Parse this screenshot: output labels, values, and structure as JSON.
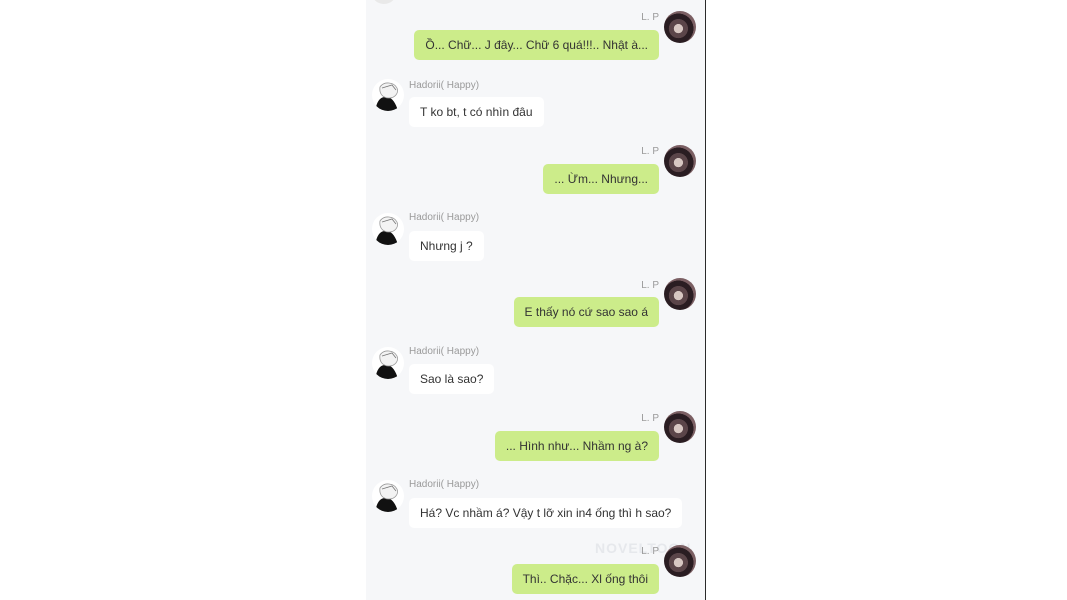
{
  "chat": {
    "watermark": "NOVELTOON",
    "messages": [
      {
        "side": "right",
        "name": "L. P",
        "text": "Ồ... Chữ... J đây... Chữ 6 quá!!!.. Nhật à..."
      },
      {
        "side": "left",
        "name": "Hadorii( Happy)",
        "text": "T ko bt, t có nhìn đâu"
      },
      {
        "side": "right",
        "name": "L. P",
        "text": "... Ừm... Nhưng..."
      },
      {
        "side": "left",
        "name": "Hadorii( Happy)",
        "text": "Nhưng j ?"
      },
      {
        "side": "right",
        "name": "L. P",
        "text": "E thấy nó cứ sao sao á"
      },
      {
        "side": "left",
        "name": "Hadorii( Happy)",
        "text": "Sao là sao?"
      },
      {
        "side": "right",
        "name": "L. P",
        "text": "... Hình như... Nhầm ng à?"
      },
      {
        "side": "left",
        "name": "Hadorii( Happy)",
        "text": "Há? Vc nhầm á? Vậy t lỡ xin in4 ống thì h sao?"
      },
      {
        "side": "right",
        "name": "L. P",
        "text": "Thì.. Chặc... Xl ống thôi"
      }
    ]
  }
}
